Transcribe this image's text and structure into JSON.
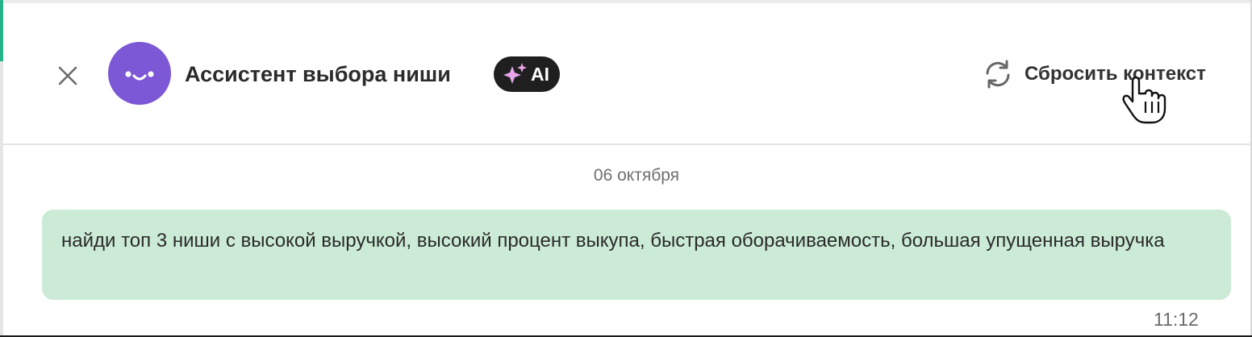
{
  "header": {
    "title": "Ассистент выбора ниши",
    "badge_label": "AI",
    "reset_label": "Сбросить контекст"
  },
  "icons": {
    "close": "close-icon",
    "avatar": "smiley-face-icon",
    "badge": "sparkles-icon",
    "reset": "refresh-icon",
    "cursor": "hand-pointer-cursor-icon"
  },
  "chat": {
    "date_label": "06 октября",
    "messages": [
      {
        "text": "найди топ 3 ниши с высокой выручкой, высокий процент выкупа, быстрая оборачиваемость, большая упущенная выручка",
        "time": "11:12"
      }
    ]
  },
  "colors": {
    "accent_green": "#27b38a",
    "avatar_purple": "#7c57d6",
    "badge_background": "#1f1f1f",
    "sparkle_pink": "#e8a6e8",
    "message_bubble": "#ccebd6"
  }
}
